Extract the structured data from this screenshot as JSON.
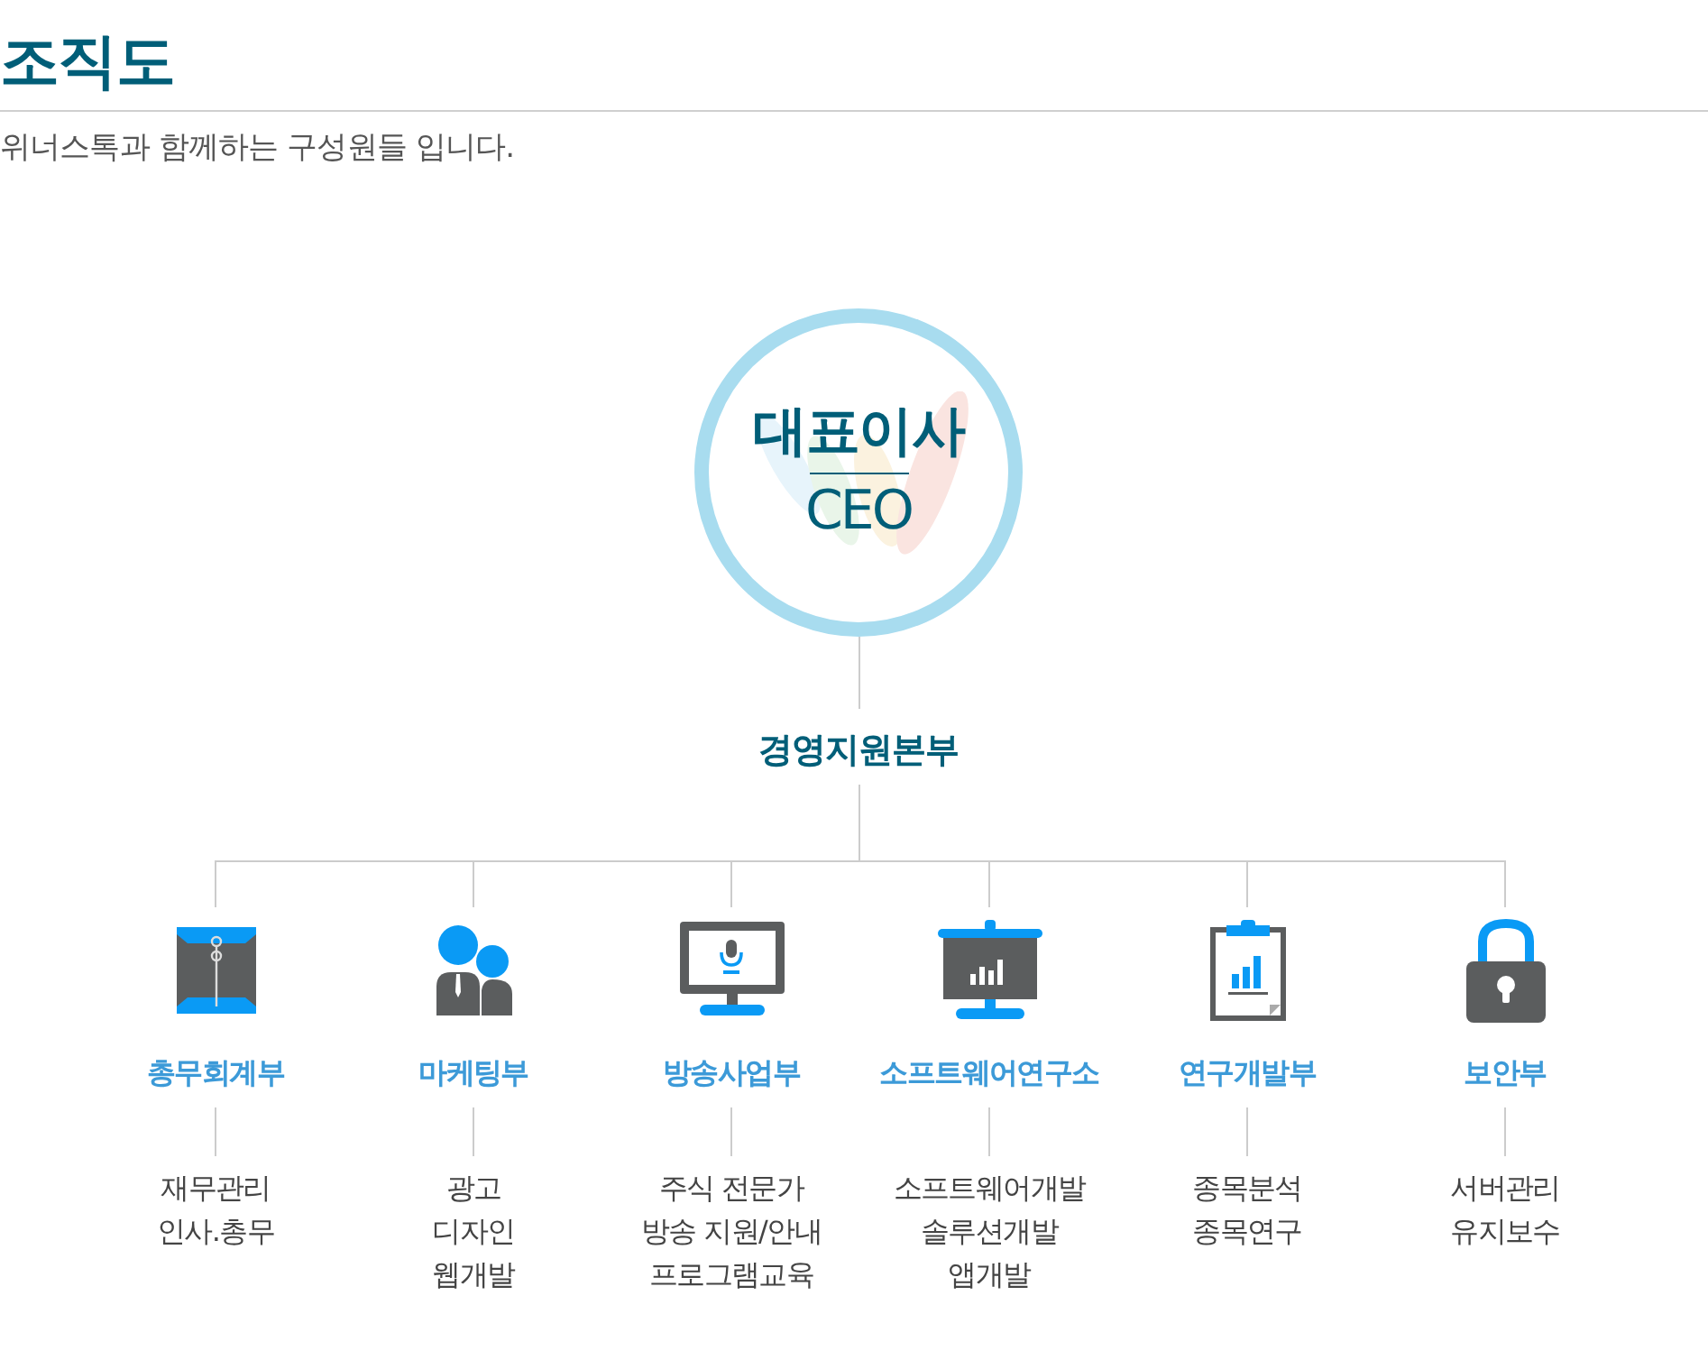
{
  "page": {
    "title": "조직도",
    "subtitle": "위너스톡과 함께하는 구성원들 입니다."
  },
  "ceo": {
    "title": "대표이사",
    "subtitle": "CEO"
  },
  "division": "경영지원본부",
  "departments": [
    {
      "kind": "envelope",
      "name": "총무회계부",
      "duties": [
        "재무관리",
        "인사.총무"
      ]
    },
    {
      "kind": "people",
      "name": "마케팅부",
      "duties": [
        "광고",
        "디자인",
        "웹개발"
      ]
    },
    {
      "kind": "monitor",
      "name": "방송사업부",
      "duties": [
        "주식 전문가",
        "방송 지원/안내",
        "프로그램교육"
      ]
    },
    {
      "kind": "presentation",
      "name": "소프트웨어연구소",
      "duties": [
        "소프트웨어개발",
        "솔루션개발",
        "앱개발"
      ]
    },
    {
      "kind": "clipboard",
      "name": "연구개발부",
      "duties": [
        "종목분석",
        "종목연구"
      ]
    },
    {
      "kind": "lock",
      "name": "보안부",
      "duties": [
        "서버관리",
        "유지보수"
      ]
    }
  ]
}
